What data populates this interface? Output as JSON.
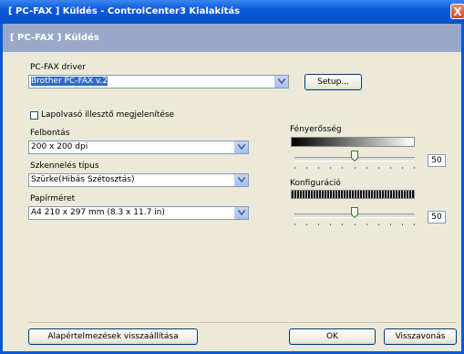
{
  "window": {
    "title": "[ PC-FAX ]  Küldés - ControlCenter3 Kialakítás",
    "close": "X"
  },
  "header": {
    "title": "[ PC-FAX ]  Küldés"
  },
  "driver": {
    "label": "PC-FAX driver",
    "value": "Brother PC-FAX v.2",
    "setup_label": "Setup..."
  },
  "scanner_ui": {
    "label": "Lapolvasó illesztő megjelenítése",
    "checked": false
  },
  "resolution": {
    "label": "Felbontás",
    "value": "200 x 200 dpi"
  },
  "scan_type": {
    "label": "Szkennelés típus",
    "value": "Szürke(Hibás Szétosztás)"
  },
  "paper_size": {
    "label": "Papírméret",
    "value": "A4 210 x 297 mm (8.3 x 11.7 in)"
  },
  "brightness": {
    "label": "Fényerősség",
    "value": "50"
  },
  "contrast": {
    "label": "Konfiguráció",
    "value": "50"
  },
  "buttons": {
    "reset": "Alapértelmezések visszaállítása",
    "ok": "OK",
    "cancel": "Visszavonás"
  }
}
